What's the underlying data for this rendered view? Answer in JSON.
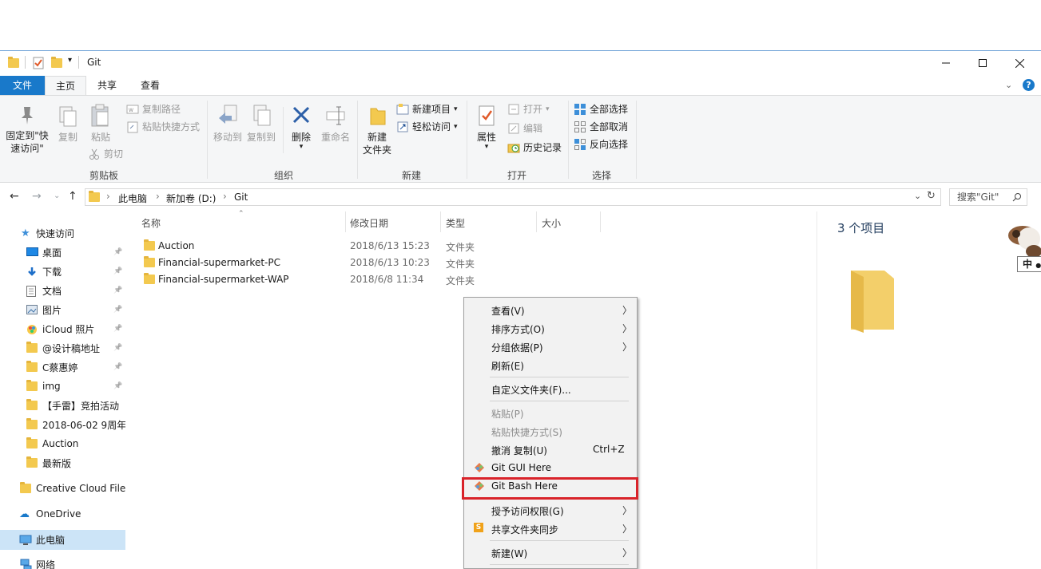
{
  "title_bar": {
    "title": "Git",
    "buttons": [
      "minimize",
      "maximize",
      "close"
    ]
  },
  "ribbon_tabs": [
    "文件",
    "主页",
    "共享",
    "查看"
  ],
  "ribbon": {
    "clipboard": {
      "pin_label_1": "固定到\"快",
      "pin_label_2": "速访问\"",
      "copy": "复制",
      "paste": "粘贴",
      "copy_path": "复制路径",
      "paste_shortcut": "粘贴快捷方式",
      "cut": "剪切",
      "group": "剪贴板"
    },
    "organize": {
      "move_to": "移动到",
      "copy_to": "复制到",
      "delete": "删除",
      "rename": "重命名",
      "group": "组织"
    },
    "new": {
      "new_folder_1": "新建",
      "new_folder_2": "文件夹",
      "new_item": "新建项目",
      "easy_access": "轻松访问",
      "group": "新建"
    },
    "open": {
      "properties": "属性",
      "open": "打开",
      "edit": "编辑",
      "history": "历史记录",
      "group": "打开"
    },
    "select": {
      "select_all": "全部选择",
      "select_none": "全部取消",
      "invert": "反向选择",
      "group": "选择"
    }
  },
  "address": {
    "crumbs": [
      "此电脑",
      "新加卷 (D:)",
      "Git"
    ],
    "search_placeholder": "搜索\"Git\""
  },
  "nav_pane": {
    "quick_access": "快速访问",
    "items": [
      {
        "label": "桌面",
        "pinned": true
      },
      {
        "label": "下载",
        "pinned": true
      },
      {
        "label": "文档",
        "pinned": true
      },
      {
        "label": "图片",
        "pinned": true
      },
      {
        "label": "iCloud 照片",
        "pinned": true
      },
      {
        "label": "@设计稿地址",
        "pinned": true
      },
      {
        "label": "C蔡惠婷",
        "pinned": true
      },
      {
        "label": "img",
        "pinned": true
      },
      {
        "label": "【手雷】竞拍活动",
        "pinned": false
      },
      {
        "label": "2018-06-02 9周年",
        "pinned": false
      },
      {
        "label": "Auction",
        "pinned": false
      },
      {
        "label": "最新版",
        "pinned": false
      }
    ],
    "creative_cloud": "Creative Cloud Files",
    "onedrive": "OneDrive",
    "this_pc": "此电脑",
    "network": "网络"
  },
  "columns": [
    "名称",
    "修改日期",
    "类型",
    "大小"
  ],
  "files": [
    {
      "name": "Auction",
      "date": "2018/6/13 15:23",
      "type": "文件夹"
    },
    {
      "name": "Financial-supermarket-PC",
      "date": "2018/6/13 10:23",
      "type": "文件夹"
    },
    {
      "name": "Financial-supermarket-WAP",
      "date": "2018/6/8 11:34",
      "type": "文件夹"
    }
  ],
  "preview": {
    "count": "3 个项目",
    "ime_label": "中"
  },
  "context_menu": {
    "view": "查看(V)",
    "sort": "排序方式(O)",
    "group_by": "分组依据(P)",
    "refresh": "刷新(E)",
    "customize": "自定义文件夹(F)...",
    "paste": "粘贴(P)",
    "paste_shortcut": "粘贴快捷方式(S)",
    "undo": "撤消 复制(U)",
    "undo_shortcut": "Ctrl+Z",
    "git_gui": "Git GUI Here",
    "git_bash": "Git Bash Here",
    "grant_access": "授予访问权限(G)",
    "share_sync": "共享文件夹同步",
    "new": "新建(W)"
  },
  "colors": {
    "accent": "#1979ca",
    "highlight_box": "#d9232a",
    "folder": "#f3c94f"
  }
}
